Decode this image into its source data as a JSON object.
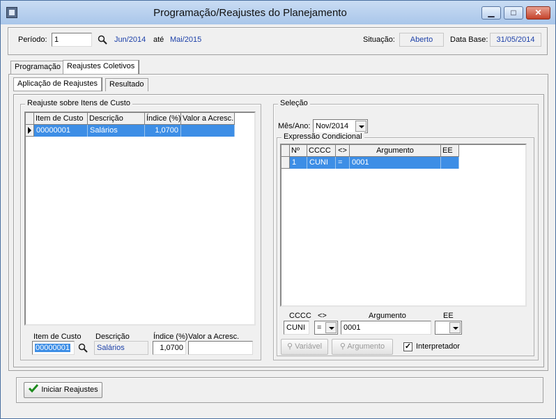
{
  "window": {
    "title": "Programação/Reajustes do Planejamento"
  },
  "header": {
    "periodo_label": "Período:",
    "periodo_value": "1",
    "start": "Jun/2014",
    "ate": "até",
    "end": "Mai/2015",
    "situacao_label": "Situação:",
    "situacao_value": "Aberto",
    "data_base_label": "Data Base:",
    "data_base_value": "31/05/2014"
  },
  "tabs": [
    "Programação",
    "Reajustes Coletivos"
  ],
  "subtabs": [
    "Aplicação de Reajustes",
    "Resultado"
  ],
  "left": {
    "group_title": "Reajuste sobre Itens de Custo",
    "columns": [
      "Item de Custo",
      "Descrição",
      "Índice (%)",
      "Valor a Acresc."
    ],
    "rows": [
      [
        "00000001",
        "Salários",
        "1,0700",
        ""
      ]
    ],
    "edit": {
      "item_label": "Item de Custo",
      "item_value": "00000001",
      "desc_label": "Descrição",
      "desc_value": "Salários",
      "indice_label": "Índice (%)",
      "indice_value": "1,0700",
      "valor_label": "Valor a Acresc.",
      "valor_value": ""
    }
  },
  "right": {
    "group_title": "Seleção",
    "mes_label": "Mês/Ano:",
    "mes_value": "Nov/2014",
    "expr_title": "Expressão Condicional",
    "columns": [
      "Nº",
      "CCCC",
      "<>",
      "Argumento",
      "EE"
    ],
    "rows": [
      [
        "1",
        "CUNI",
        "=",
        "0001",
        ""
      ]
    ],
    "edit": {
      "cccc_label": "CCCC",
      "cccc_value": "CUNI",
      "op_label": "<>",
      "op_value": "=",
      "arg_label": "Argumento",
      "arg_value": "0001",
      "ee_label": "EE",
      "ee_value": ""
    },
    "btn_variavel": "Variável",
    "btn_argumento": "Argumento",
    "interpretador_label": "Interpretador",
    "interpretador_checked": true
  },
  "footer": {
    "iniciar_label": "Iniciar Reajustes"
  },
  "colors": {
    "selection": "#3d8ee6",
    "accent_text": "#1b3fa8"
  }
}
